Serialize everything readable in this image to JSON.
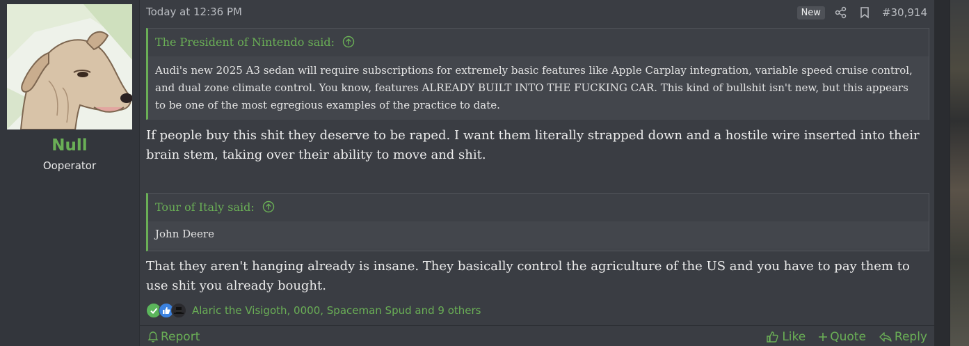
{
  "user": {
    "name": "Null",
    "title": "Ooperator"
  },
  "post": {
    "timestamp": "Today at 12:36 PM",
    "new_badge": "New",
    "number": "#30,914",
    "quote1": {
      "author": "The President of Nintendo said:",
      "text": "Audi's new 2025 A3 sedan will require subscriptions for extremely basic features like Apple Carplay integration, variable speed cruise control, and dual zone climate control. You know, features ALREADY BUILT INTO THE FUCKING CAR. This kind of bullshit isn't new, but this appears to be one of the most egregious examples of the practice to date."
    },
    "paragraph1": "If people buy this shit they deserve to be raped. I want them literally strapped down and a hostile wire inserted into their brain stem, taking over their ability to move and shit.",
    "quote2": {
      "author": "Tour of Italy said:",
      "text": "John Deere"
    },
    "paragraph2": "That they aren't hanging already is insane. They basically control the agriculture of the US and you have to pay them to use shit you already bought.",
    "reactions": {
      "icons": [
        "check-reaction-icon",
        "thumbs-up-reaction-icon",
        "top-hat-reaction-icon"
      ],
      "text": "Alaric the Visigoth, 0000, Spaceman Spud and 9 others"
    }
  },
  "actions": {
    "report": "Report",
    "like": "Like",
    "quote": "Quote",
    "reply": "Reply"
  },
  "colors": {
    "accent": "#6aaf56",
    "post_bg": "#3a3d43",
    "user_bg": "#33363c",
    "quote_bg": "#43464c",
    "text": "#ececec"
  }
}
